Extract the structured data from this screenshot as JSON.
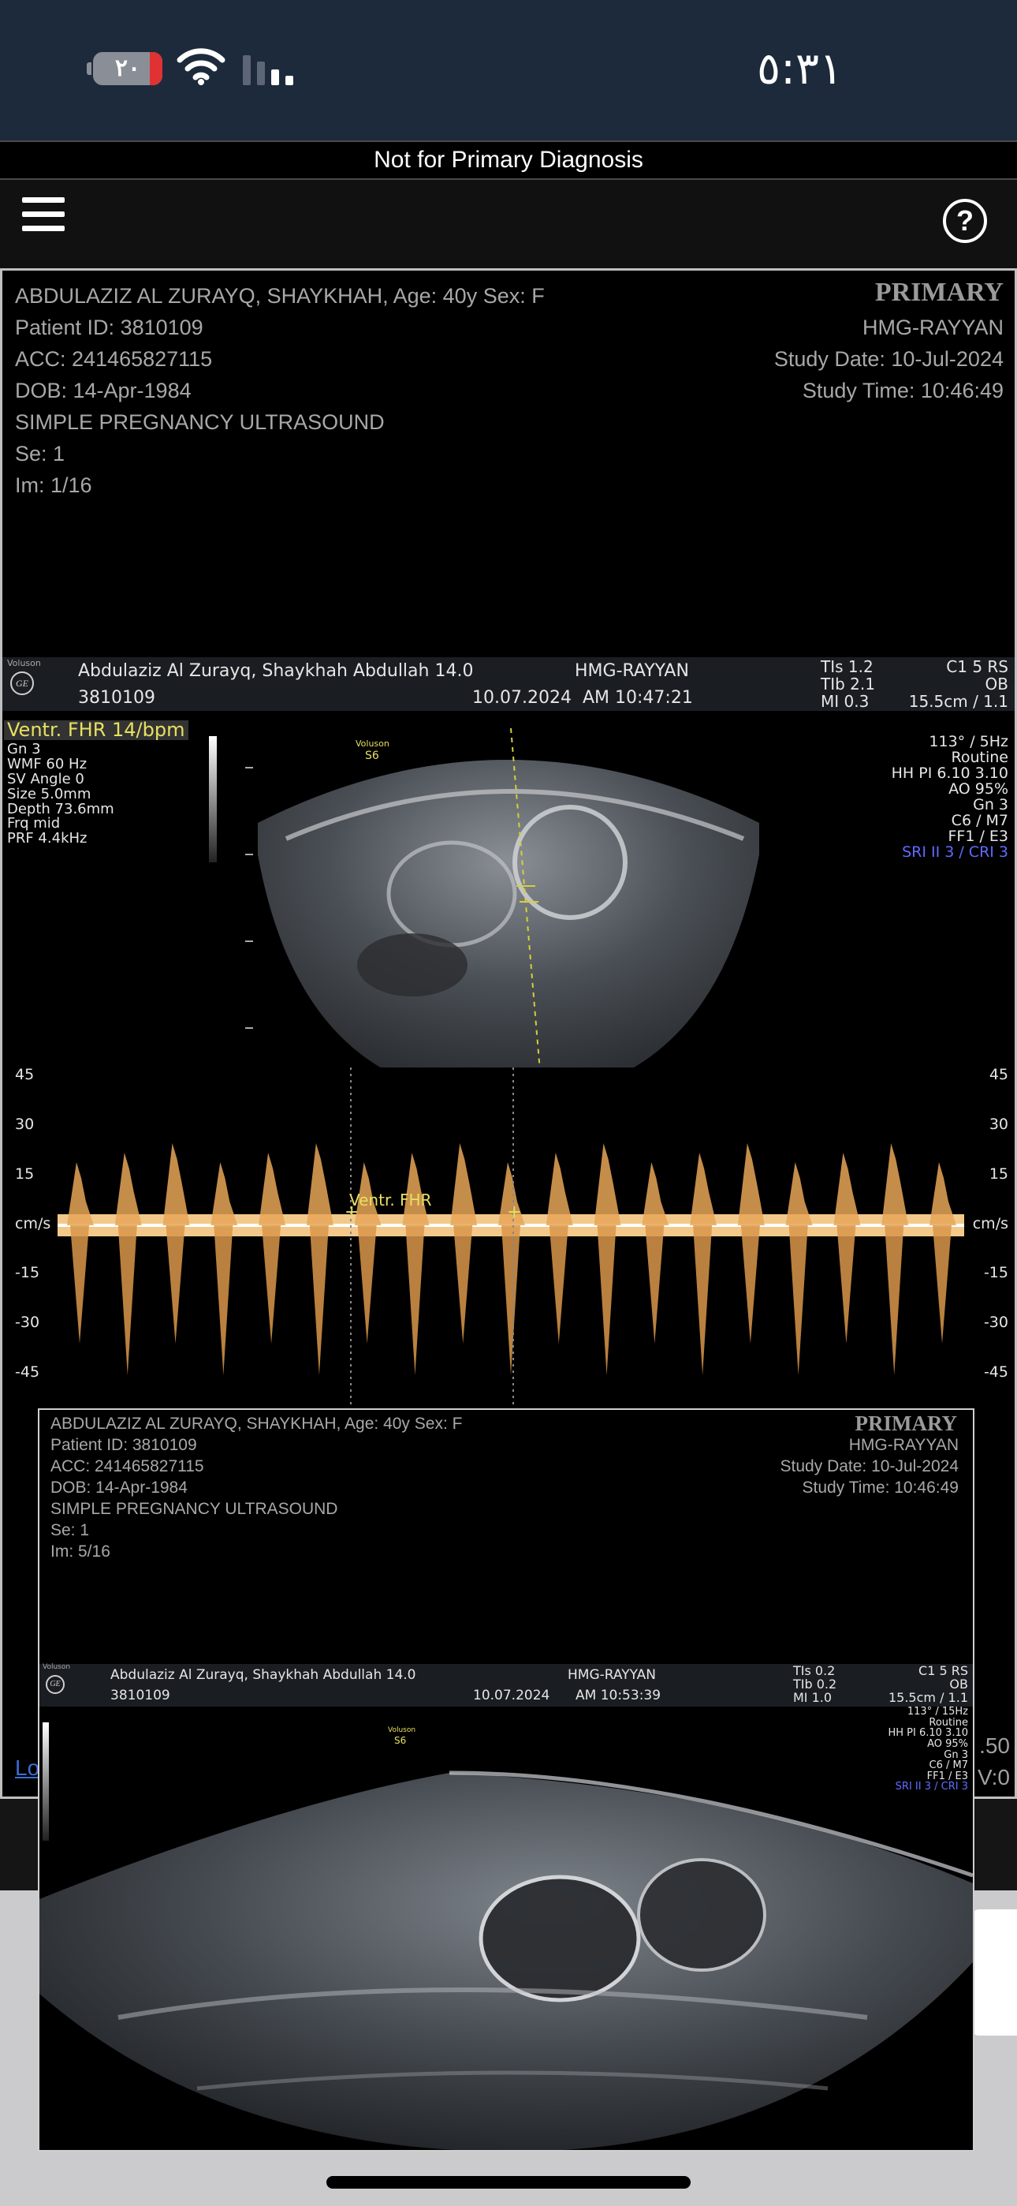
{
  "status_bar": {
    "battery_level": "٢٠",
    "time": "٥:٣١",
    "icons": [
      "battery-icon",
      "wifi-icon",
      "cellular-signal-icon"
    ]
  },
  "banner": {
    "text": "Not for Primary Diagnosis"
  },
  "toolbar": {
    "icons": [
      "hamburger-menu-icon",
      "help-icon"
    ],
    "help_glyph": "?"
  },
  "viewer1": {
    "patient_line": "ABDULAZIZ AL ZURAYQ, SHAYKHAH,  Age: 40y  Sex: F",
    "patient_id": "Patient ID: 3810109",
    "acc": "ACC: 241465827115",
    "dob": "DOB: 14-Apr-1984",
    "study_desc": "SIMPLE PREGNANCY ULTRASOUND",
    "series": "Se: 1",
    "image": "Im: 1/16",
    "primary": "PRIMARY",
    "institution": "HMG-RAYYAN",
    "study_date": "Study Date: 10-Jul-2024",
    "study_time": "Study Time: 10:46:49",
    "us_header": {
      "brand": "Voluson",
      "logo": "GE",
      "patient": "Abdulaziz Al Zurayq, Shaykhah   Abdullah 14.0",
      "hospital": "HMG-RAYYAN",
      "id": "3810109",
      "date": "10.07.2024",
      "time": "AM 10:47:21",
      "tis": "TIs  1.2",
      "tib": "TIb  2.1",
      "mi": "MI  0.3",
      "probe": "C1 5 RS",
      "mode": "OB",
      "depth": "15.5cm / 1.1"
    },
    "measure_label": "Ventr. FHR 14/bpm",
    "left_params": [
      "Gn   3",
      "WMF 60 Hz",
      "SV Angle  0",
      "Size  5.0mm",
      "Depth 73.6mm",
      "Frq mid",
      "PRF  4.4kHz"
    ],
    "right_params": [
      "113° / 5Hz",
      "Routine",
      "HH PI 6.10  3.10",
      "AO 95%",
      "Gn  3",
      "C6 / M7",
      "FF1 / E3"
    ],
    "right_params_blue": "SRI II 3 / CRI 3",
    "volume_label": "Voluson",
    "volume_sub": "S6",
    "doppler_scale_left": [
      "45",
      "30",
      "15",
      "cm/s",
      "-15",
      "-30",
      "-45"
    ],
    "doppler_scale_right": [
      "45",
      "30",
      "15",
      "cm/s",
      "-15",
      "-30",
      "-45"
    ],
    "doppler_marker": "Ventr. FHR"
  },
  "viewer2": {
    "patient_line": "ABDULAZIZ AL ZURAYQ, SHAYKHAH,  Age: 40y  Sex: F",
    "patient_id": "Patient ID: 3810109",
    "acc": "ACC: 241465827115",
    "dob": "DOB: 14-Apr-1984",
    "study_desc": "SIMPLE PREGNANCY ULTRASOUND",
    "series": "Se: 1",
    "image": "Im: 5/16",
    "primary": "PRIMARY",
    "institution": "HMG-RAYYAN",
    "study_date": "Study Date: 10-Jul-2024",
    "study_time": "Study Time: 10:46:49",
    "us_header": {
      "brand": "Voluson",
      "logo": "GE",
      "patient": "Abdulaziz Al Zurayq, Shaykhah   Abdullah 14.0",
      "hospital": "HMG-RAYYAN",
      "id": "3810109",
      "date": "10.07.2024",
      "time": "AM 10:53:39",
      "tis": "TIs  0.2",
      "tib": "TIb  0.2",
      "mi": "MI  1.0",
      "probe": "C1 5 RS",
      "mode": "OB",
      "depth": "15.5cm / 1.1"
    },
    "right_params": [
      "113° / 15Hz",
      "Routine",
      "HH PI 6.10  3.10",
      "AO 95%",
      "Gn  3",
      "C6 / M7",
      "FF1 / E3"
    ],
    "right_params_blue": "SRI II 3 / CRI 3",
    "volume_label": "Voluson",
    "volume_sub": "S6"
  },
  "behind_text": {
    "link_fragment": "Lo",
    "value_top": ".50",
    "value_bottom": "V:0"
  }
}
